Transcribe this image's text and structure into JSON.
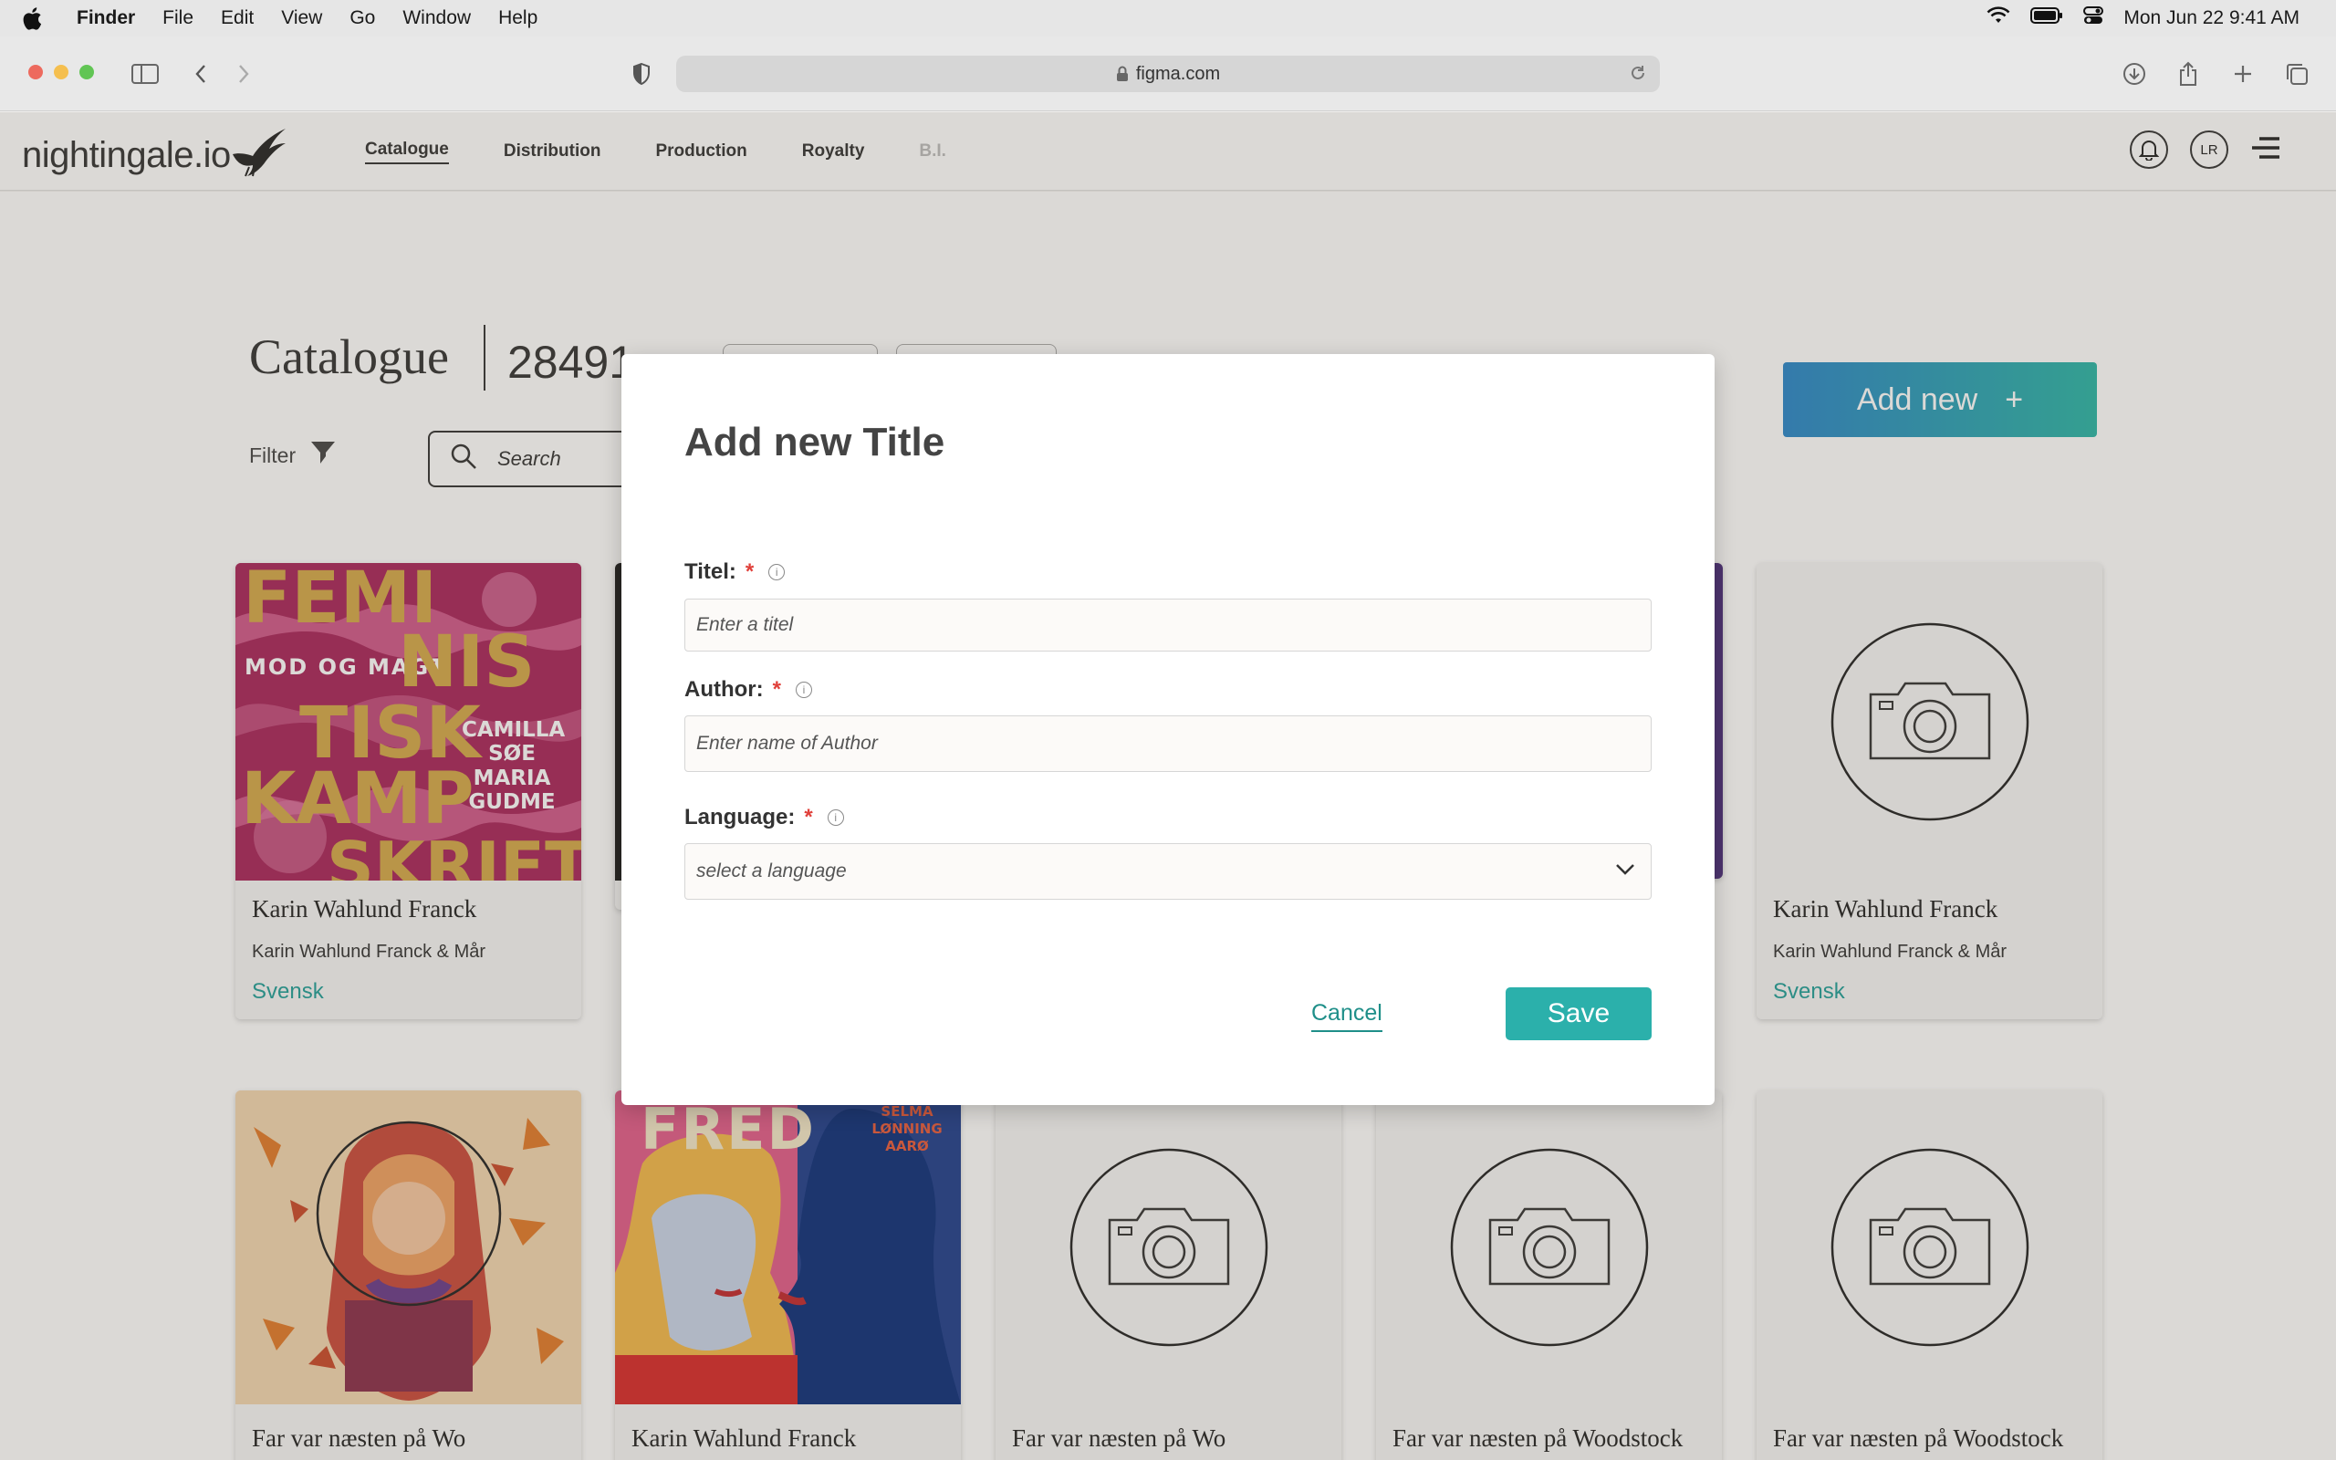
{
  "menubar": {
    "app": "Finder",
    "items": [
      "File",
      "Edit",
      "View",
      "Go",
      "Window",
      "Help"
    ],
    "datetime": "Mon Jun 22  9:41 AM"
  },
  "browser": {
    "url": "figma.com"
  },
  "header": {
    "logo": "nightingale.io",
    "nav": [
      {
        "label": "Catalogue",
        "active": true
      },
      {
        "label": "Distribution"
      },
      {
        "label": "Production"
      },
      {
        "label": "Royalty"
      },
      {
        "label": "B.I.",
        "disabled": true
      }
    ],
    "avatar": "LR"
  },
  "page": {
    "title": "Catalogue",
    "count": "28491",
    "filter_label": "Filter",
    "search_placeholder": "Search",
    "add_new_label": "Add new",
    "add_new_icon": "+"
  },
  "cards": [
    {
      "title": "Karin Wahlund Franck",
      "author": "Karin Wahlund Franck & Mår",
      "language": "Svensk",
      "cover": "feministisk"
    },
    {
      "title": "Karin Wahlund Franck",
      "author": "Karin Wahlund Franck & Mår",
      "language": "Svensk",
      "cover": "placeholder"
    },
    {
      "title": "Far var næsten på Wo",
      "cover": "autumn"
    },
    {
      "title": "Karin Wahlund Franck",
      "cover": "fred"
    },
    {
      "title": "Far var næsten på Wo",
      "cover": "placeholder"
    },
    {
      "title": "Far var næsten på Woodstock",
      "cover": "placeholder"
    },
    {
      "title": "Far var næsten på Woodstock",
      "cover": "placeholder"
    }
  ],
  "covers": {
    "feministisk": {
      "line1": "FEMI",
      "line2": "NIS",
      "line3": "TISK",
      "line4": "KAMP",
      "line5": "SKRIFT",
      "series": "MOD OG MAGT",
      "authors": [
        "CAMILLA",
        "SØE",
        "MARIA",
        "GUDME"
      ]
    },
    "fred": {
      "title": "FRED",
      "author": [
        "SELMA",
        "LØNNING",
        "AARØ"
      ]
    }
  },
  "modal": {
    "title": "Add new Title",
    "fields": {
      "title": {
        "label": "Titel:",
        "required": "*",
        "placeholder": "Enter a  titel"
      },
      "author": {
        "label": "Author:",
        "required": "*",
        "placeholder": "Enter name of Author"
      },
      "language": {
        "label": "Language:",
        "required": "*",
        "placeholder": "select a language"
      }
    },
    "cancel_label": "Cancel",
    "save_label": "Save"
  },
  "colors": {
    "accent": "#2bb0ab",
    "required": "#e0403a",
    "link": "#1f8f89",
    "gradient_start": "#2a86c9",
    "gradient_end": "#2ab5a6"
  }
}
